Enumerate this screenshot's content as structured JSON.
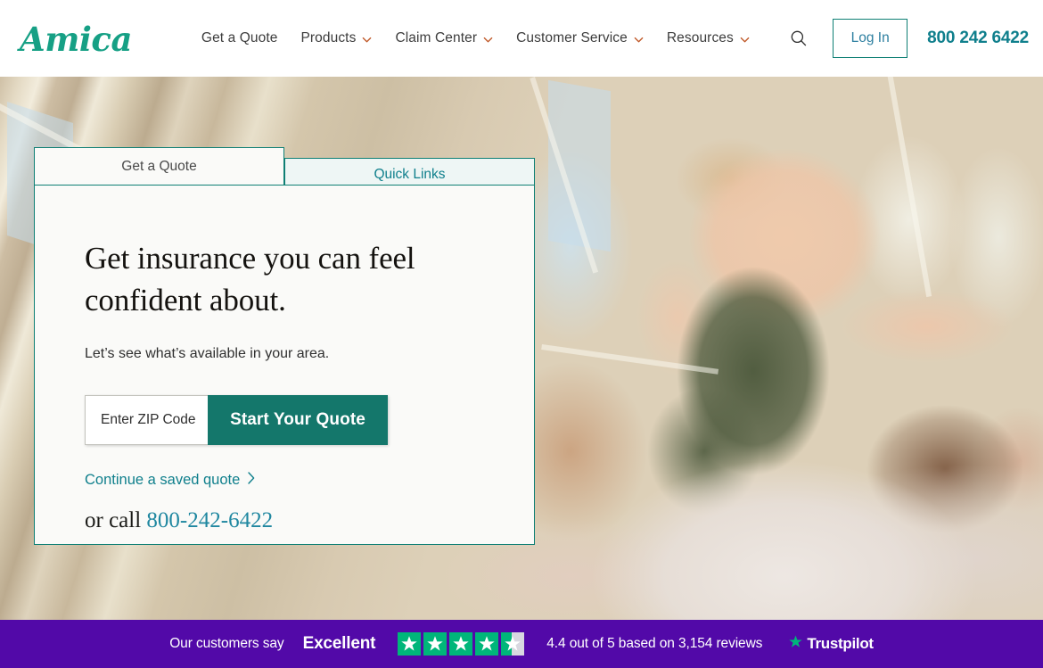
{
  "brand": {
    "logo_text": "Amica",
    "logo_color": "#16a085",
    "teal": "#0e7f74",
    "accent_orange": "#c05a2a",
    "link_teal": "#0f7f8c"
  },
  "header": {
    "nav": [
      {
        "label": "Get a Quote",
        "has_caret": false
      },
      {
        "label": "Products",
        "has_caret": true
      },
      {
        "label": "Claim Center",
        "has_caret": true
      },
      {
        "label": "Customer Service",
        "has_caret": true
      },
      {
        "label": "Resources",
        "has_caret": true
      }
    ],
    "search_icon": "search-icon",
    "login_label": "Log In",
    "phone": "800 242 6422"
  },
  "hero": {
    "tabs": [
      {
        "label": "Get a Quote",
        "active": true
      },
      {
        "label": "Quick Links",
        "active": false
      }
    ],
    "headline": "Get insurance you can feel confident about.",
    "subhead": "Let’s see what’s available in your area.",
    "zip_placeholder": "Enter ZIP Code",
    "zip_value": "",
    "quote_button": "Start Your Quote",
    "saved_quote_link": "Continue a saved quote",
    "saved_quote_arrow": "›",
    "or_call_prefix": "or call ",
    "or_call_phone": "800-242-6422"
  },
  "trustpilot": {
    "lead_text": "Our customers say",
    "rating_word": "Excellent",
    "stars_total": 5,
    "stars_filled": 4.4,
    "summary": "4.4 out of 5 based on 3,154 reviews",
    "logo_text": "Trustpilot",
    "bar_color": "#5209a8",
    "star_color": "#00b67a",
    "star_empty_color": "#d8d8e0"
  }
}
